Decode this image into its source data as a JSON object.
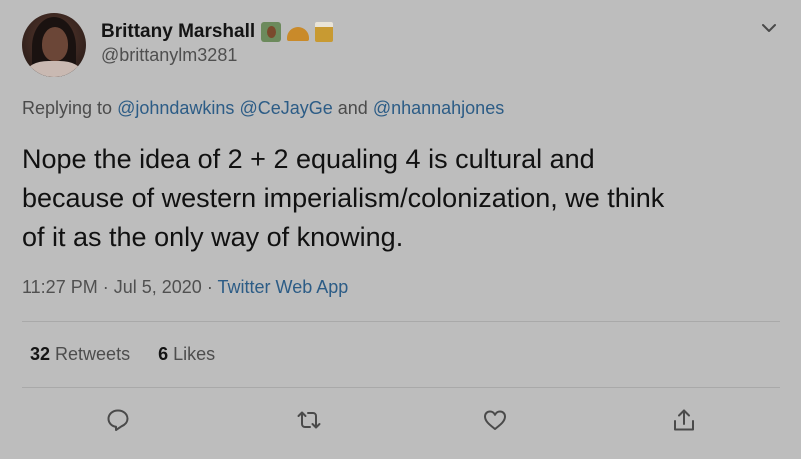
{
  "author": {
    "display_name": "Brittany Marshall",
    "handle": "@brittanylm3281",
    "name_emojis": [
      "teacher-emoji",
      "taco-emoji",
      "beer-emoji"
    ]
  },
  "reply": {
    "prefix": "Replying to",
    "mentions": [
      "@johndawkins",
      "@CeJayGe",
      "@nhannahjones"
    ],
    "conjunction": "and"
  },
  "tweet": {
    "text": "Nope the idea of 2 + 2 equaling 4 is cultural and\nbecause of western imperialism/colonization, we think\nof it as the only way of knowing."
  },
  "meta": {
    "time": "11:27 PM",
    "separator": "·",
    "date": "Jul 5, 2020",
    "source": "Twitter Web App"
  },
  "stats": {
    "retweets_count": "32",
    "retweets_label": "Retweets",
    "likes_count": "6",
    "likes_label": "Likes"
  },
  "actions": [
    {
      "name": "reply",
      "icon": "reply-icon"
    },
    {
      "name": "retweet",
      "icon": "retweet-icon"
    },
    {
      "name": "like",
      "icon": "heart-icon"
    },
    {
      "name": "share",
      "icon": "share-icon"
    }
  ],
  "colors": {
    "background": "#bdbdbd",
    "link": "#2c5c86",
    "text": "#111111",
    "muted": "#505050"
  }
}
